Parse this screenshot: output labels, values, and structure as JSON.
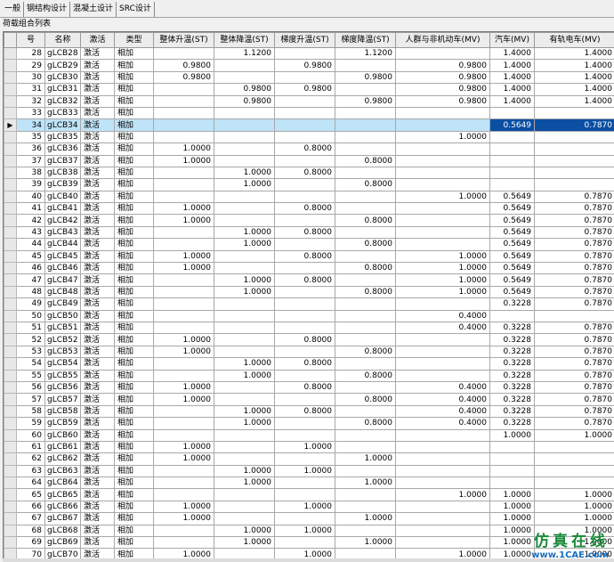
{
  "tabs": [
    "一般",
    "钢结构设计",
    "混凝土设计",
    "SRC设计"
  ],
  "group_label": "荷载组合列表",
  "columns": [
    "号",
    "名称",
    "激活",
    "类型",
    "整体升温(ST)",
    "整体降温(ST)",
    "梯度升温(ST)",
    "梯度降温(ST)",
    "人群与非机动车(MV)",
    "汽车(MV)",
    "有轨电车(MV)"
  ],
  "current_row_marker": "▶",
  "rows": [
    [
      "28",
      "gLCB28",
      "激活",
      "相加",
      "",
      "1.1200",
      "",
      "1.1200",
      "",
      "1.4000",
      "1.4000"
    ],
    [
      "29",
      "gLCB29",
      "激活",
      "相加",
      "0.9800",
      "",
      "0.9800",
      "",
      "0.9800",
      "1.4000",
      "1.4000"
    ],
    [
      "30",
      "gLCB30",
      "激活",
      "相加",
      "0.9800",
      "",
      "",
      "0.9800",
      "0.9800",
      "1.4000",
      "1.4000"
    ],
    [
      "31",
      "gLCB31",
      "激活",
      "相加",
      "",
      "0.9800",
      "0.9800",
      "",
      "0.9800",
      "1.4000",
      "1.4000"
    ],
    [
      "32",
      "gLCB32",
      "激活",
      "相加",
      "",
      "0.9800",
      "",
      "0.9800",
      "0.9800",
      "1.4000",
      "1.4000"
    ],
    [
      "33",
      "gLCB33",
      "激活",
      "相加",
      "",
      "",
      "",
      "",
      "",
      "",
      ""
    ],
    [
      "34",
      "gLCB34",
      "激活",
      "相加",
      "",
      "",
      "",
      "",
      "",
      "0.5649",
      "0.7870"
    ],
    [
      "35",
      "gLCB35",
      "激活",
      "相加",
      "",
      "",
      "",
      "",
      "1.0000",
      "",
      ""
    ],
    [
      "36",
      "gLCB36",
      "激活",
      "相加",
      "1.0000",
      "",
      "0.8000",
      "",
      "",
      "",
      ""
    ],
    [
      "37",
      "gLCB37",
      "激活",
      "相加",
      "1.0000",
      "",
      "",
      "0.8000",
      "",
      "",
      ""
    ],
    [
      "38",
      "gLCB38",
      "激活",
      "相加",
      "",
      "1.0000",
      "0.8000",
      "",
      "",
      "",
      ""
    ],
    [
      "39",
      "gLCB39",
      "激活",
      "相加",
      "",
      "1.0000",
      "",
      "0.8000",
      "",
      "",
      ""
    ],
    [
      "40",
      "gLCB40",
      "激活",
      "相加",
      "",
      "",
      "",
      "",
      "1.0000",
      "0.5649",
      "0.7870"
    ],
    [
      "41",
      "gLCB41",
      "激活",
      "相加",
      "1.0000",
      "",
      "0.8000",
      "",
      "",
      "0.5649",
      "0.7870"
    ],
    [
      "42",
      "gLCB42",
      "激活",
      "相加",
      "1.0000",
      "",
      "",
      "0.8000",
      "",
      "0.5649",
      "0.7870"
    ],
    [
      "43",
      "gLCB43",
      "激活",
      "相加",
      "",
      "1.0000",
      "0.8000",
      "",
      "",
      "0.5649",
      "0.7870"
    ],
    [
      "44",
      "gLCB44",
      "激活",
      "相加",
      "",
      "1.0000",
      "",
      "0.8000",
      "",
      "0.5649",
      "0.7870"
    ],
    [
      "45",
      "gLCB45",
      "激活",
      "相加",
      "1.0000",
      "",
      "0.8000",
      "",
      "1.0000",
      "0.5649",
      "0.7870"
    ],
    [
      "46",
      "gLCB46",
      "激活",
      "相加",
      "1.0000",
      "",
      "",
      "0.8000",
      "1.0000",
      "0.5649",
      "0.7870"
    ],
    [
      "47",
      "gLCB47",
      "激活",
      "相加",
      "",
      "1.0000",
      "0.8000",
      "",
      "1.0000",
      "0.5649",
      "0.7870"
    ],
    [
      "48",
      "gLCB48",
      "激活",
      "相加",
      "",
      "1.0000",
      "",
      "0.8000",
      "1.0000",
      "0.5649",
      "0.7870"
    ],
    [
      "49",
      "gLCB49",
      "激活",
      "相加",
      "",
      "",
      "",
      "",
      "",
      "0.3228",
      "0.7870"
    ],
    [
      "50",
      "gLCB50",
      "激活",
      "相加",
      "",
      "",
      "",
      "",
      "0.4000",
      "",
      ""
    ],
    [
      "51",
      "gLCB51",
      "激活",
      "相加",
      "",
      "",
      "",
      "",
      "0.4000",
      "0.3228",
      "0.7870"
    ],
    [
      "52",
      "gLCB52",
      "激活",
      "相加",
      "1.0000",
      "",
      "0.8000",
      "",
      "",
      "0.3228",
      "0.7870"
    ],
    [
      "53",
      "gLCB53",
      "激活",
      "相加",
      "1.0000",
      "",
      "",
      "0.8000",
      "",
      "0.3228",
      "0.7870"
    ],
    [
      "54",
      "gLCB54",
      "激活",
      "相加",
      "",
      "1.0000",
      "0.8000",
      "",
      "",
      "0.3228",
      "0.7870"
    ],
    [
      "55",
      "gLCB55",
      "激活",
      "相加",
      "",
      "1.0000",
      "",
      "0.8000",
      "",
      "0.3228",
      "0.7870"
    ],
    [
      "56",
      "gLCB56",
      "激活",
      "相加",
      "1.0000",
      "",
      "0.8000",
      "",
      "0.4000",
      "0.3228",
      "0.7870"
    ],
    [
      "57",
      "gLCB57",
      "激活",
      "相加",
      "1.0000",
      "",
      "",
      "0.8000",
      "0.4000",
      "0.3228",
      "0.7870"
    ],
    [
      "58",
      "gLCB58",
      "激活",
      "相加",
      "",
      "1.0000",
      "0.8000",
      "",
      "0.4000",
      "0.3228",
      "0.7870"
    ],
    [
      "59",
      "gLCB59",
      "激活",
      "相加",
      "",
      "1.0000",
      "",
      "0.8000",
      "0.4000",
      "0.3228",
      "0.7870"
    ],
    [
      "60",
      "gLCB60",
      "激活",
      "相加",
      "",
      "",
      "",
      "",
      "",
      "1.0000",
      "1.0000"
    ],
    [
      "61",
      "gLCB61",
      "激活",
      "相加",
      "1.0000",
      "",
      "1.0000",
      "",
      "",
      "",
      ""
    ],
    [
      "62",
      "gLCB62",
      "激活",
      "相加",
      "1.0000",
      "",
      "",
      "1.0000",
      "",
      "",
      ""
    ],
    [
      "63",
      "gLCB63",
      "激活",
      "相加",
      "",
      "1.0000",
      "1.0000",
      "",
      "",
      "",
      ""
    ],
    [
      "64",
      "gLCB64",
      "激活",
      "相加",
      "",
      "1.0000",
      "",
      "1.0000",
      "",
      "",
      ""
    ],
    [
      "65",
      "gLCB65",
      "激活",
      "相加",
      "",
      "",
      "",
      "",
      "1.0000",
      "1.0000",
      "1.0000"
    ],
    [
      "66",
      "gLCB66",
      "激活",
      "相加",
      "1.0000",
      "",
      "1.0000",
      "",
      "",
      "1.0000",
      "1.0000"
    ],
    [
      "67",
      "gLCB67",
      "激活",
      "相加",
      "1.0000",
      "",
      "",
      "1.0000",
      "",
      "1.0000",
      "1.0000"
    ],
    [
      "68",
      "gLCB68",
      "激活",
      "相加",
      "",
      "1.0000",
      "1.0000",
      "",
      "",
      "1.0000",
      "1.0000"
    ],
    [
      "69",
      "gLCB69",
      "激活",
      "相加",
      "",
      "1.0000",
      "",
      "1.0000",
      "",
      "1.0000",
      "1.0000"
    ],
    [
      "70",
      "gLCB70",
      "激活",
      "相加",
      "1.0000",
      "",
      "1.0000",
      "",
      "1.0000",
      "1.0000",
      "1.0000"
    ]
  ],
  "current_row_index": 6,
  "highlight_color": "#0b4fa3",
  "current_row_color": "#bfe3f7",
  "watermark": {
    "text": "仿真在线",
    "url": "www.1CAE.com"
  }
}
